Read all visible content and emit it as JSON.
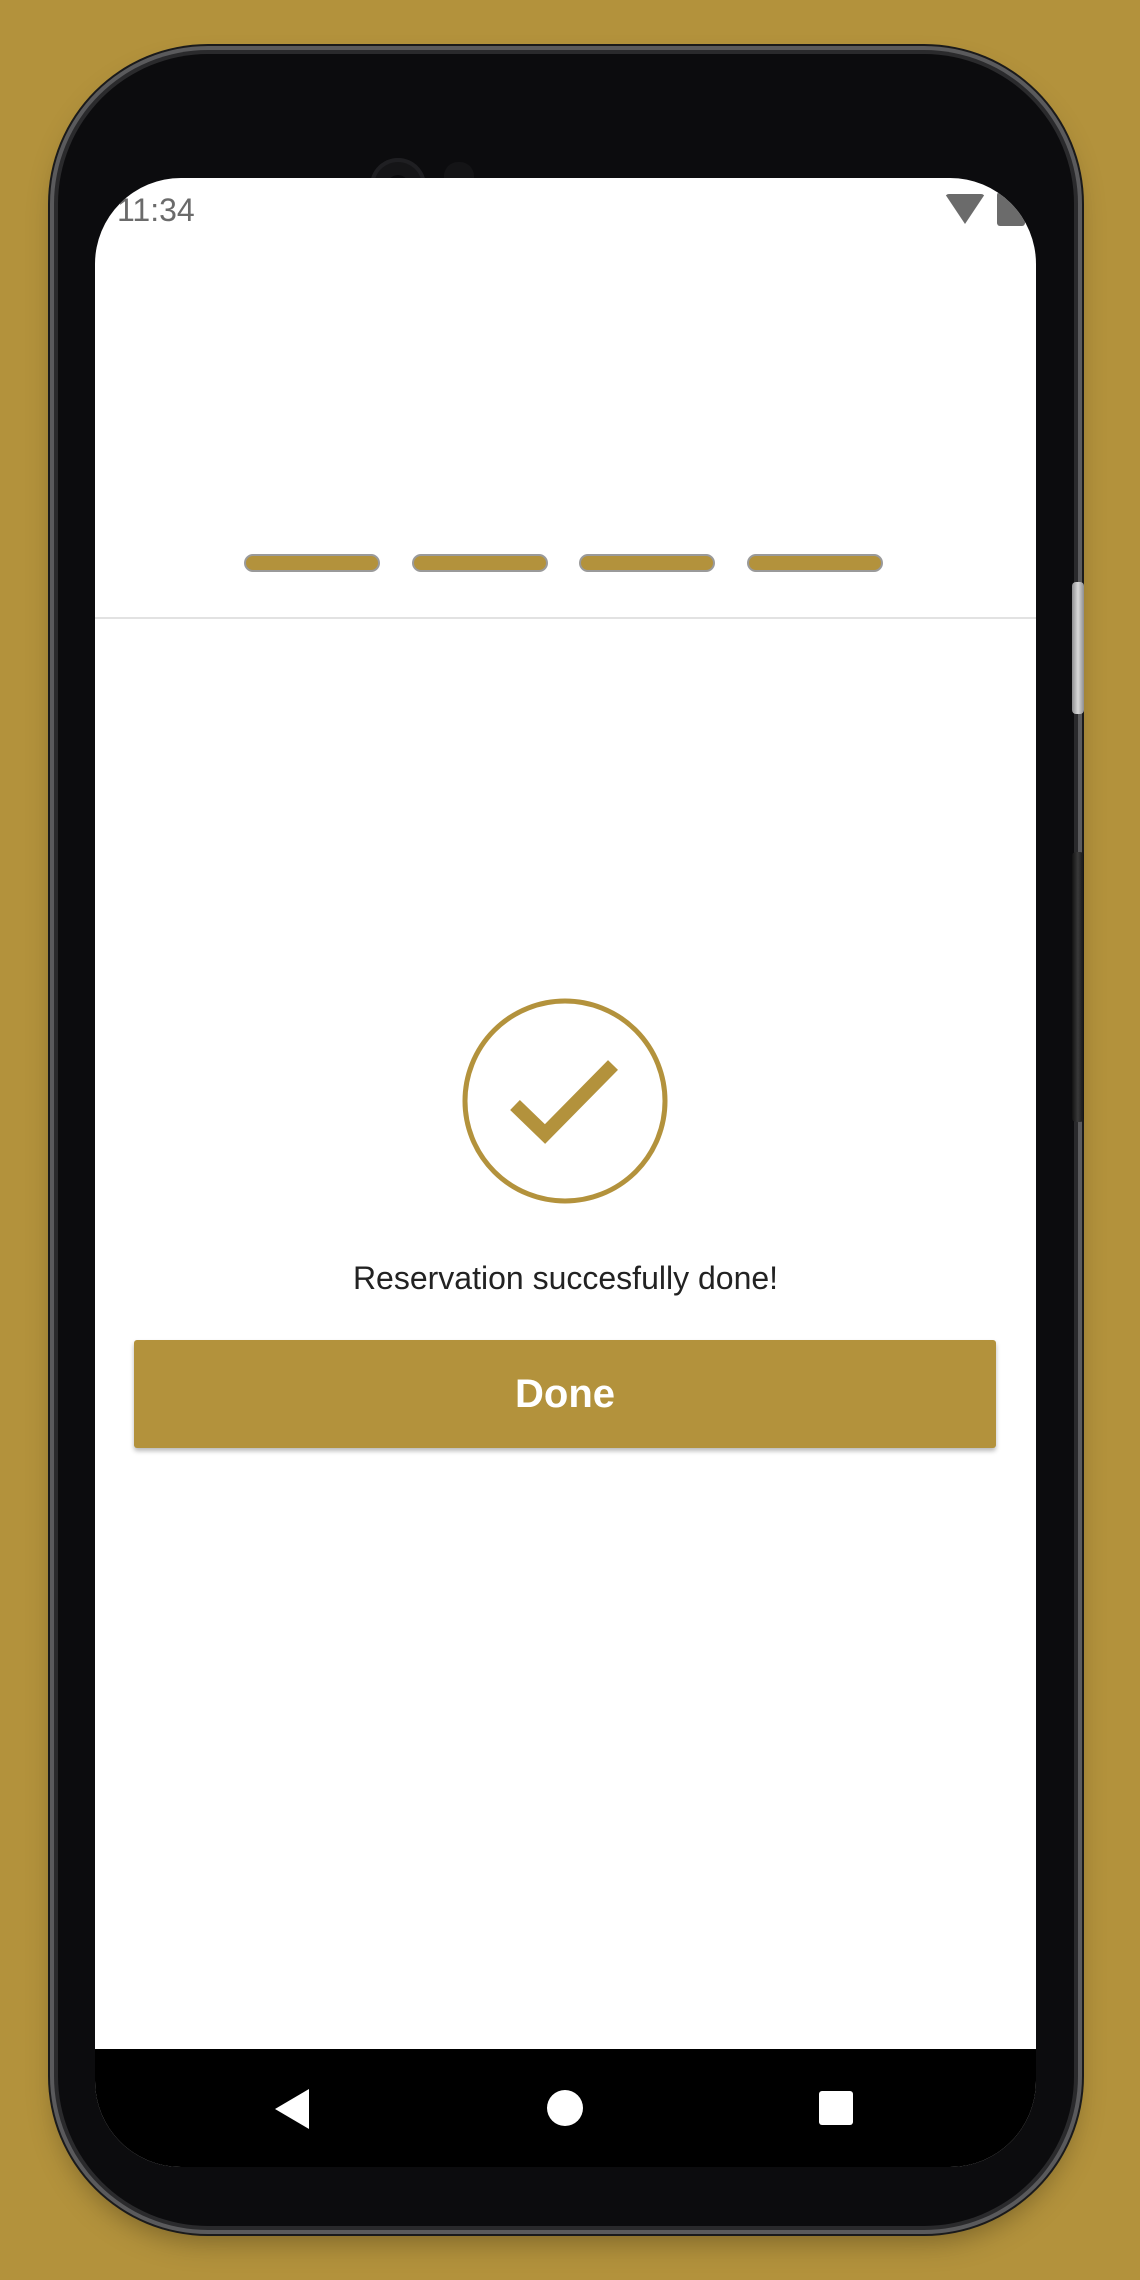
{
  "status_bar": {
    "time": "11:34",
    "icons": [
      "wifi-icon",
      "battery-icon"
    ]
  },
  "stepper": {
    "steps_total": 4,
    "steps_completed": 4,
    "active_color": "#b3923c"
  },
  "confirmation": {
    "icon": "check-circle-icon",
    "message": "Reservation succesfully done!",
    "done_label": "Done"
  },
  "navigation_bar": {
    "icons": [
      "back-icon",
      "home-icon",
      "recents-icon"
    ]
  },
  "colors": {
    "accent": "#b3923c",
    "background": "#ffffff",
    "text": "#222222"
  }
}
